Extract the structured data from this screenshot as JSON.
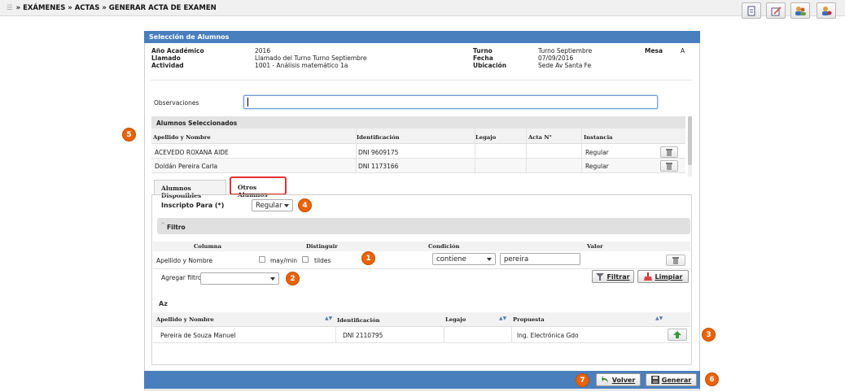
{
  "breadcrumb": "» EXÁMENES » ACTAS » GENERAR ACTA DE EXAMEN",
  "panel_title": "Selección de Alumnos",
  "info": {
    "anio_label": "Año Académico",
    "anio_value": "2016",
    "llamado_label": "Llamado",
    "llamado_value": "Llamado del Turno Turno Septiembre",
    "actividad_label": "Actividad",
    "actividad_value": "1001 - Análisis matemático 1a",
    "turno_label": "Turno",
    "turno_value": "Turno Septiembre",
    "fecha_label": "Fecha",
    "fecha_value": "07/09/2016",
    "ubicacion_label": "Ubicación",
    "ubicacion_value": "Sede Av Santa Fe",
    "mesa_label": "Mesa",
    "mesa_value": "A"
  },
  "observaciones_label": "Observaciones",
  "selected": {
    "title": "Alumnos Seleccionados",
    "headers": [
      "Apellido y Nombre",
      "Identificación",
      "Legajo",
      "Acta N°",
      "Instancia"
    ],
    "rows": [
      {
        "nombre": "ACEVEDO ROXANA AIDE",
        "id": "DNI 9609175",
        "legajo": "",
        "acta": "",
        "instancia": "Regular"
      },
      {
        "nombre": "Doldán Pereira Carla",
        "id": "DNI 1173166",
        "legajo": "",
        "acta": "",
        "instancia": "Regular"
      }
    ]
  },
  "tabs": [
    "Alumnos Disponibles",
    "Otros Alumnos"
  ],
  "inscripto_label": "Inscripto Para (*)",
  "inscripto_value": "Regular",
  "filtro": {
    "title": "Filtro",
    "headers": [
      "Columna",
      "Distinguir",
      "Condición",
      "Valor"
    ],
    "column": "Apellido y Nombre",
    "mayusculas": "may/min",
    "tildes": "tildes",
    "condicion": "contiene",
    "valor": "pereira",
    "agregar_label": "Agregar filtro",
    "agregar_value": "",
    "filtrar_label": "Filtrar",
    "limpiar_label": "Limpiar"
  },
  "results": {
    "sort_icon": "Az",
    "headers": [
      "Apellido y Nombre",
      "Identificación",
      "Legajo",
      "Propuesta"
    ],
    "rows": [
      {
        "nombre": "Pereira de Souza Manuel",
        "id": "DNI 2110795",
        "legajo": "",
        "propuesta": "Ing. Electrónica Gdo"
      }
    ]
  },
  "footer": {
    "volver_label": "Volver",
    "generar_label": "Generar"
  },
  "badges": [
    "1",
    "2",
    "3",
    "4",
    "5",
    "6",
    "7"
  ],
  "colors": {
    "header_blue": "#4a7fbd",
    "badge_orange": "#e8630a",
    "tab_highlight": "#e03030"
  }
}
